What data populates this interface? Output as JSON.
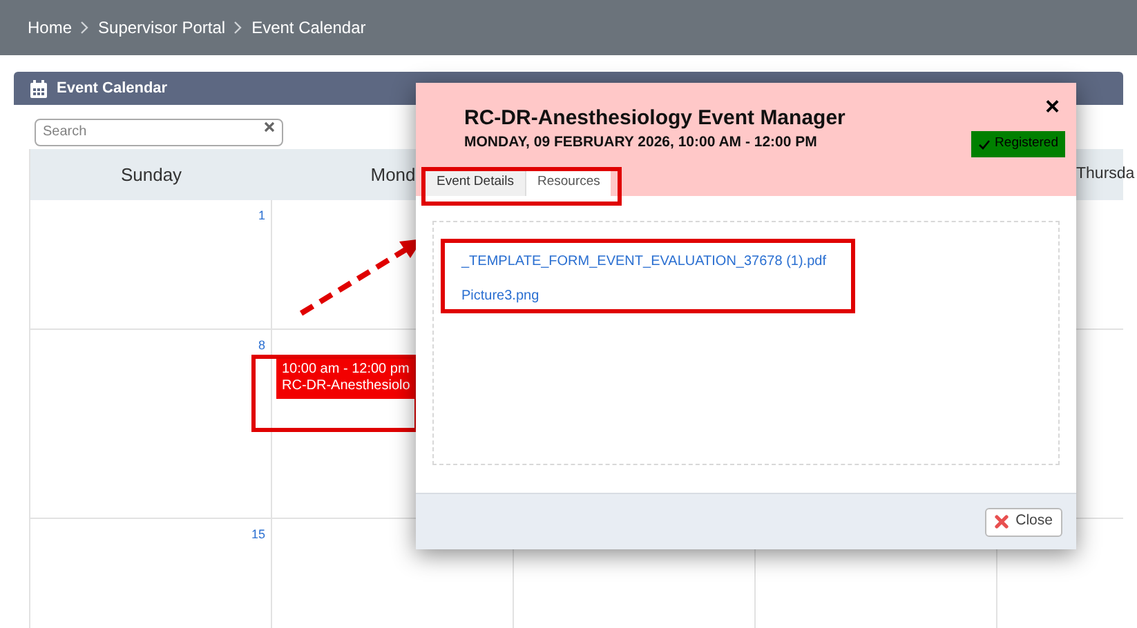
{
  "breadcrumb": [
    "Home",
    "Supervisor Portal",
    "Event Calendar"
  ],
  "panel": {
    "title": "Event Calendar",
    "search": {
      "placeholder": "Search"
    }
  },
  "calendar": {
    "columns": [
      {
        "label": "Sunday"
      },
      {
        "label": "Mond"
      },
      {},
      {},
      {
        "label": "Thursda"
      }
    ],
    "weeks": [
      {
        "day": "1"
      },
      {
        "day": "8",
        "event": {
          "time": "10:00 am - 12:00 pm",
          "title": "RC-DR-Anesthesiolo"
        }
      },
      {
        "day": "15"
      }
    ]
  },
  "modal": {
    "title": "RC-DR-Anesthesiology Event Manager",
    "subtitle": "MONDAY, 09 FEBRUARY 2026, 10:00 AM - 12:00 PM",
    "close_glyph": "×",
    "status": "Registered",
    "tabs": [
      {
        "label": "Event Details",
        "selected": false
      },
      {
        "label": "Resources",
        "selected": true
      }
    ],
    "files": [
      "_TEMPLATE_FORM_EVENT_EVALUATION_37678 (1).pdf",
      "Picture3.png"
    ],
    "footer_button": "Close"
  }
}
